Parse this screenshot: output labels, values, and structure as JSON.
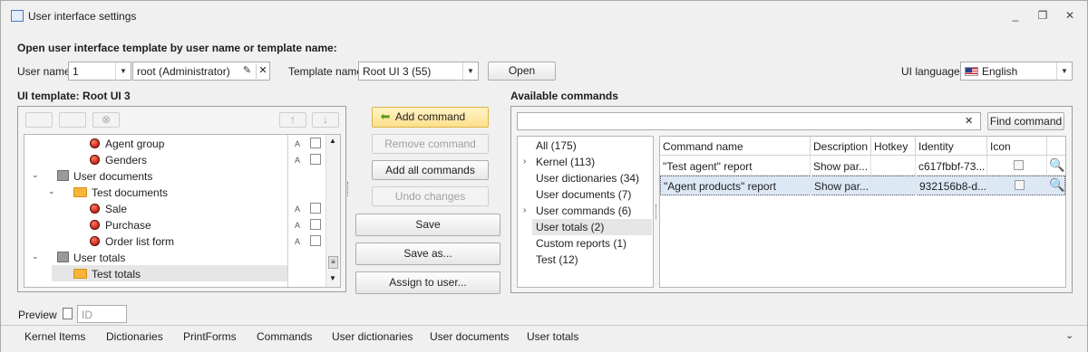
{
  "window": {
    "title": "User interface settings",
    "minimize": "_",
    "restore": "❐",
    "close": "✕"
  },
  "open_section": {
    "heading": "Open user interface template by user name or template name:",
    "user_name_label": "User name",
    "user_id": "1",
    "user_display": "root (Administrator)",
    "template_name_label": "Template name",
    "template_value": "Root UI 3 (55)",
    "open_button": "Open",
    "ui_language_label": "UI language:",
    "ui_language_value": "English"
  },
  "template_panel": {
    "heading": "UI template:",
    "template_name": "Root UI 3",
    "tree": [
      {
        "label": "Agent group",
        "icon": "bug",
        "a": "A"
      },
      {
        "label": "Genders",
        "icon": "bug",
        "a": "A"
      },
      {
        "label": "User documents",
        "icon": "user-folder"
      },
      {
        "label": "Test documents",
        "icon": "folder"
      },
      {
        "label": "Sale",
        "icon": "bug",
        "a": "A"
      },
      {
        "label": "Purchase",
        "icon": "bug",
        "a": "A"
      },
      {
        "label": "Order list form",
        "icon": "bug",
        "a": "A"
      },
      {
        "label": "User totals",
        "icon": "user-folder"
      },
      {
        "label": "Test totals",
        "icon": "folder"
      }
    ]
  },
  "actions": {
    "add_command": "Add command",
    "remove_command": "Remove command",
    "add_all_commands": "Add all commands",
    "undo_changes": "Undo changes",
    "save": "Save",
    "save_as": "Save as...",
    "assign_to_user": "Assign to user..."
  },
  "available": {
    "heading": "Available commands",
    "search_value": "",
    "find_button": "Find command",
    "categories": [
      "All (175)",
      "Kernel (113)",
      "User dictionaries (34)",
      "User documents (7)",
      "User commands (6)",
      "User totals (2)",
      "Custom reports (1)",
      "Test (12)"
    ],
    "columns": [
      "Command name",
      "Description",
      "Hotkey",
      "Identity",
      "Icon"
    ],
    "rows": [
      {
        "name": "\"Test agent\" report",
        "description": "Show par...",
        "hotkey": "",
        "identity": "c617fbbf-73..."
      },
      {
        "name": "\"Agent products\" report",
        "description": "Show par...",
        "hotkey": "",
        "identity": "932156b8-d..."
      }
    ]
  },
  "preview": {
    "label": "Preview",
    "placeholder": "ID"
  },
  "tabs": [
    "Kernel Items",
    "Dictionaries",
    "PrintForms",
    "Commands",
    "User dictionaries",
    "User documents",
    "User totals"
  ],
  "colors": {
    "selection": "#dde8f5",
    "highlight_button": "#fde08b",
    "folder": "#f5b53a"
  }
}
